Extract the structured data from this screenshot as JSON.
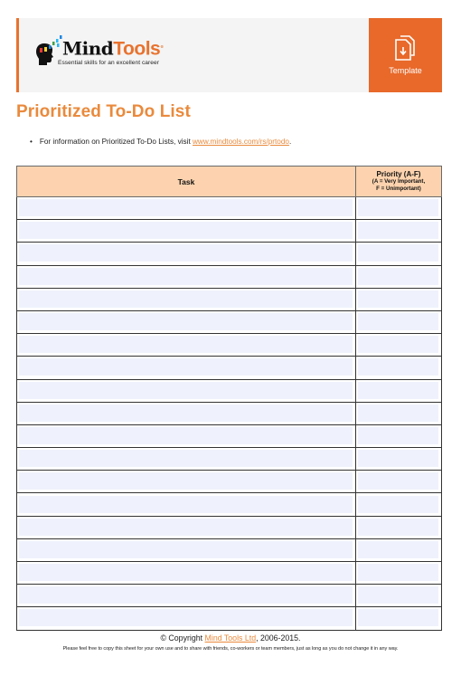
{
  "header": {
    "logo": {
      "word_part1": "Mind",
      "word_part2": "Tools",
      "registered_mark": "®",
      "tagline": "Essential skills for an excellent career",
      "icon": "head-with-ideas-icon"
    },
    "template_button": {
      "label": "Template",
      "icon": "document-download-icon"
    }
  },
  "page": {
    "title": "Prioritized To-Do List",
    "info": {
      "bullet": "•",
      "text_before": "For information on Prioritized To-Do Lists, visit ",
      "link_text": "www.mindtools.com/rs/prtodo",
      "text_after": "."
    }
  },
  "table": {
    "columns": [
      {
        "label": "Task"
      },
      {
        "label": "Priority (A-F)",
        "sublabel_line1": "(A = Very Important,",
        "sublabel_line2": "F = Unimportant)"
      }
    ],
    "rows": [
      {
        "task": "",
        "priority": ""
      },
      {
        "task": "",
        "priority": ""
      },
      {
        "task": "",
        "priority": ""
      },
      {
        "task": "",
        "priority": ""
      },
      {
        "task": "",
        "priority": ""
      },
      {
        "task": "",
        "priority": ""
      },
      {
        "task": "",
        "priority": ""
      },
      {
        "task": "",
        "priority": ""
      },
      {
        "task": "",
        "priority": ""
      },
      {
        "task": "",
        "priority": ""
      },
      {
        "task": "",
        "priority": ""
      },
      {
        "task": "",
        "priority": ""
      },
      {
        "task": "",
        "priority": ""
      },
      {
        "task": "",
        "priority": ""
      },
      {
        "task": "",
        "priority": ""
      },
      {
        "task": "",
        "priority": ""
      },
      {
        "task": "",
        "priority": ""
      },
      {
        "task": "",
        "priority": ""
      },
      {
        "task": "",
        "priority": ""
      }
    ]
  },
  "footer": {
    "copyright_prefix": "© Copyright ",
    "company_link": "Mind Tools Ltd",
    "copyright_suffix": ", 2006-2015.",
    "note": "Please feel free to copy this sheet for your own use and to share with friends, co-workers or team members, just as long as you do not change it in any way."
  },
  "colors": {
    "brand_orange": "#e8692a",
    "title_orange": "#ea8a3c",
    "header_fill": "#fcd3ae",
    "field_fill": "#eff2fc"
  }
}
